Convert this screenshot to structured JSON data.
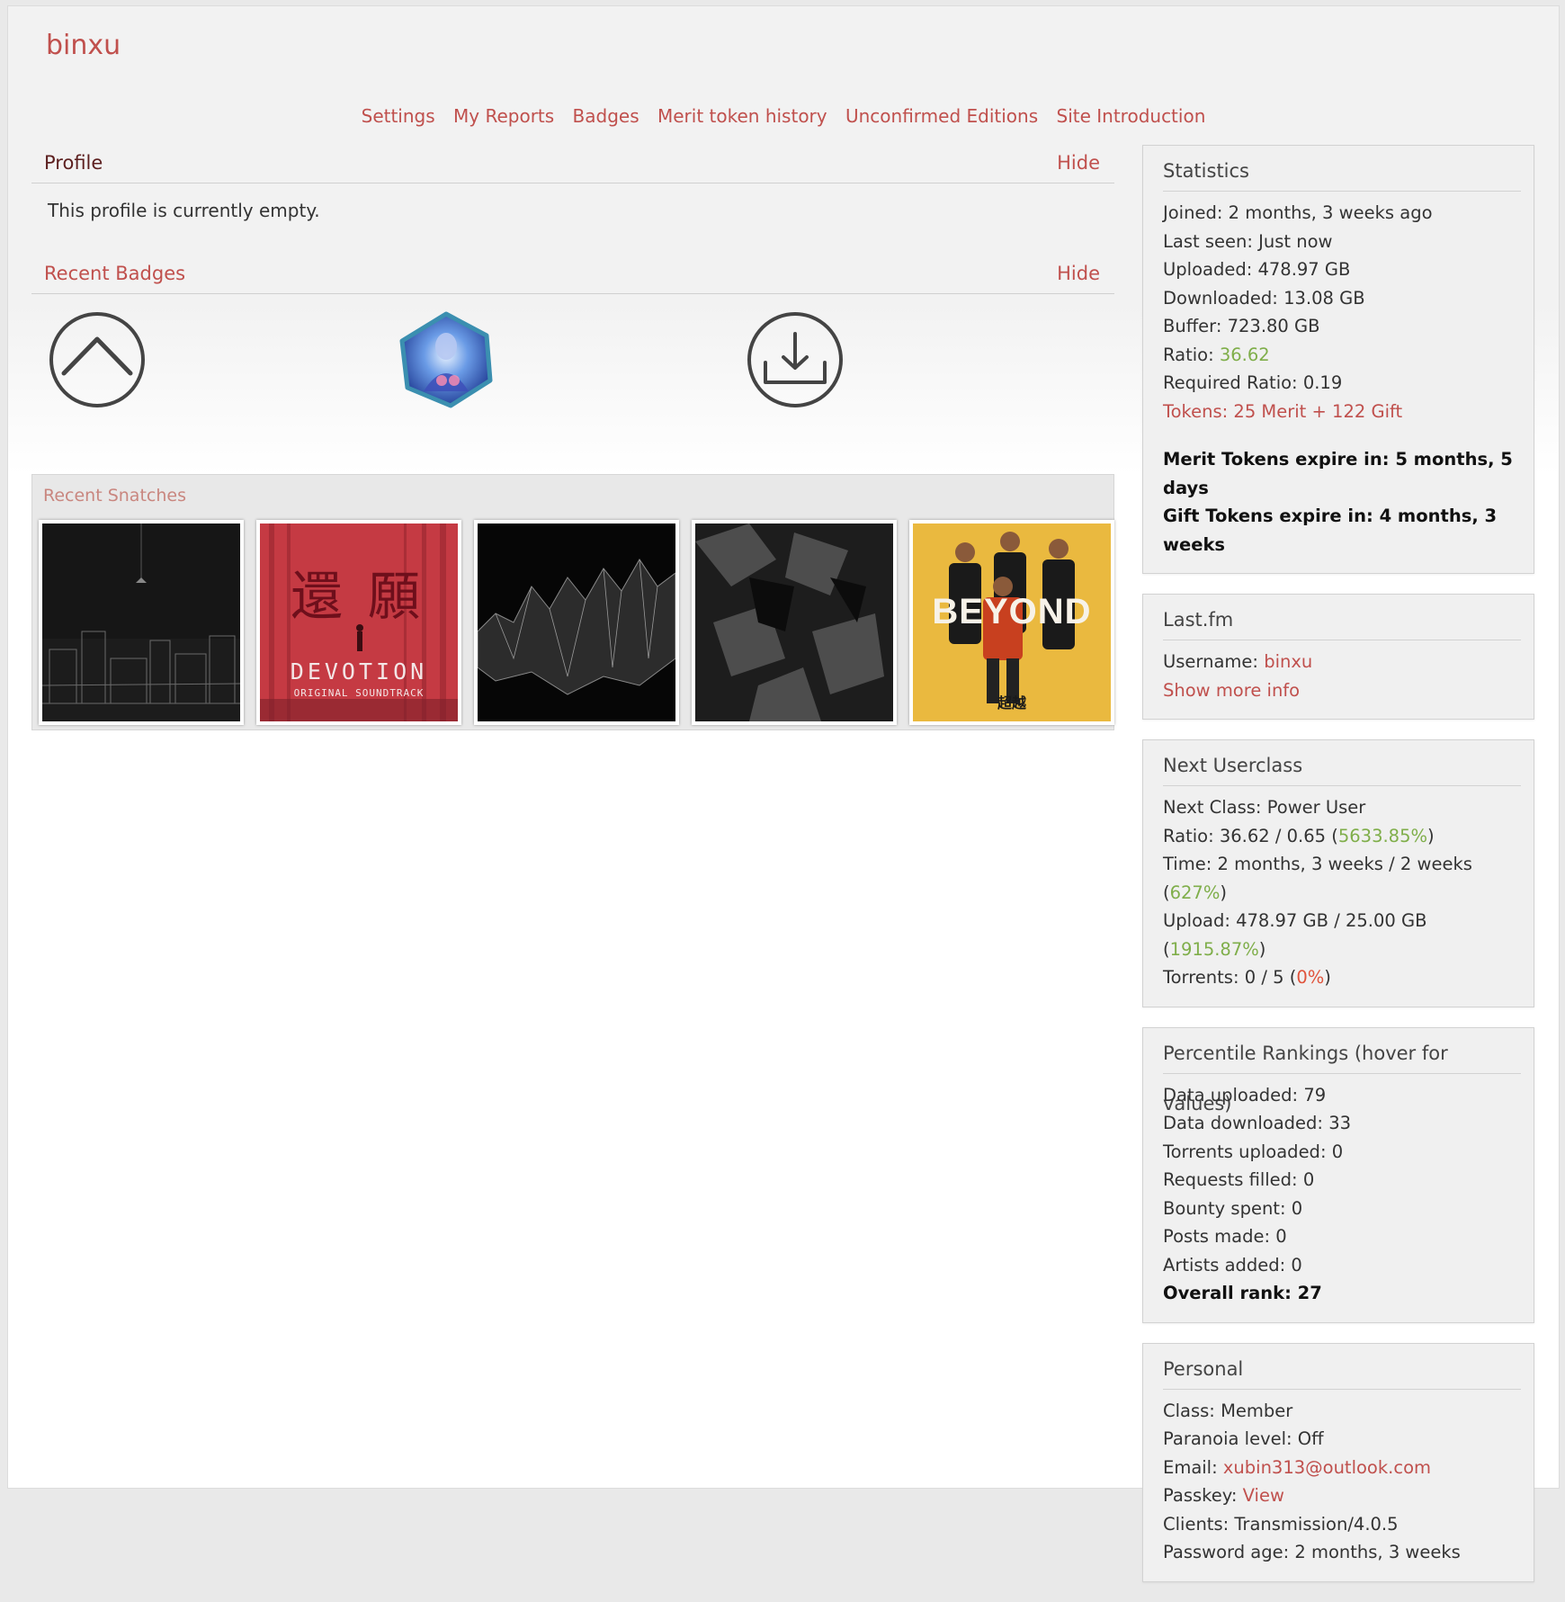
{
  "username": "binxu",
  "nav": [
    "Settings",
    "My Reports",
    "Badges",
    "Merit token history",
    "Unconfirmed Editions",
    "Site Introduction"
  ],
  "profile": {
    "title": "Profile",
    "hide": "Hide",
    "body": "This profile is currently empty."
  },
  "badges_section": {
    "title": "Recent Badges",
    "hide": "Hide",
    "badges": [
      "upload-arrow-badge-icon",
      "fantasy-hexagon-badge-icon",
      "download-arrow-badge-icon"
    ]
  },
  "snatches": {
    "title": "Recent Snatches"
  },
  "statistics": {
    "title": "Statistics",
    "joined": "Joined: 2 months, 3 weeks ago",
    "last_seen": "Last seen: Just now",
    "uploaded": "Uploaded: 478.97 GB",
    "downloaded": "Downloaded: 13.08 GB",
    "buffer": "Buffer: 723.80 GB",
    "ratio_label": "Ratio: ",
    "ratio_value": "36.62",
    "required_ratio": "Required Ratio: 0.19",
    "tokens": "Tokens: 25 Merit + 122 Gift",
    "merit_expire": "Merit Tokens expire in: 5 months, 5 days",
    "gift_expire": "Gift Tokens expire in: 4 months, 3 weeks"
  },
  "lastfm": {
    "title": "Last.fm",
    "username_label": "Username: ",
    "username_value": "binxu",
    "show_more": "Show more info"
  },
  "next_userclass": {
    "title": "Next Userclass",
    "next_class": "Next Class: Power User",
    "ratio_text": "Ratio: 36.62 / 0.65 (",
    "ratio_pct": "5633.85%",
    "time_text": "Time: 2 months, 3 weeks / 2 weeks (",
    "time_pct": "627%",
    "upload_text": "Upload: 478.97 GB / 25.00 GB (",
    "upload_pct": "1915.87%",
    "torrents_text": "Torrents: 0 / 5 (",
    "torrents_pct": "0%",
    "close": ")"
  },
  "percentile": {
    "title": "Percentile Rankings (hover for values)",
    "data_uploaded": "Data uploaded: 79",
    "data_downloaded": "Data downloaded: 33",
    "torrents_uploaded": "Torrents uploaded: 0",
    "requests_filled": "Requests filled: 0",
    "bounty_spent": "Bounty spent: 0",
    "posts_made": "Posts made: 0",
    "artists_added": "Artists added: 0",
    "overall_rank": "Overall rank: 27"
  },
  "personal": {
    "title": "Personal",
    "class": "Class: Member",
    "paranoia": "Paranoia level: Off",
    "email_label": "Email: ",
    "email_value": "xubin313@outlook.com",
    "passkey_label": "Passkey: ",
    "passkey_value": "View",
    "clients": "Clients: Transmission/4.0.5",
    "password_age": "Password age: 2 months, 3 weeks"
  },
  "covers": {
    "devotion_title": "DEVOTION",
    "devotion_sub": "ORIGINAL SOUNDTRACK",
    "devotion_chars": "還願",
    "beyond_title": "BEYOND",
    "beyond_sub": "超越"
  },
  "colors": {
    "accent": "#c0504d",
    "positive": "#7fae4a",
    "negative": "#e0533b"
  }
}
